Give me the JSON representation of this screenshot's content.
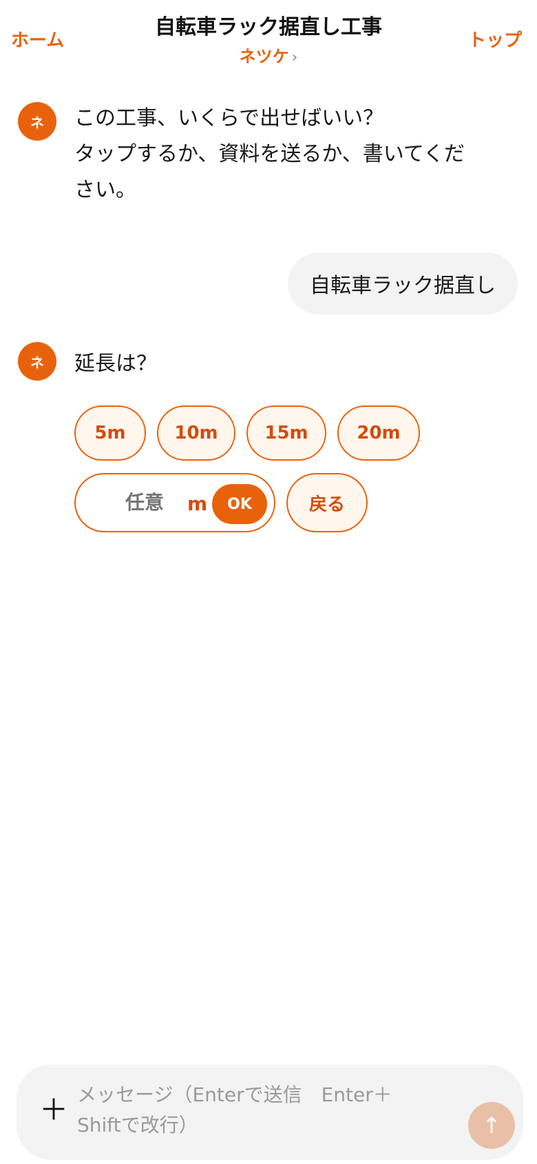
{
  "header": {
    "home_label": "ホーム",
    "top_label": "トップ",
    "title": "自転車ラック据直し工事",
    "assistant_name": "ネツケ",
    "assistant_chevron": "›"
  },
  "messages": [
    {
      "role": "assistant",
      "avatar_text": "ネ",
      "lines": [
        "この工事、いくらで出せばいい？",
        "タップするか、資料を送るか、書いてくだ",
        "さい。"
      ]
    },
    {
      "role": "user",
      "text": "自転車ラック据直し"
    },
    {
      "role": "assistant",
      "avatar_text": "ネ",
      "text": "延長は？"
    }
  ],
  "options": [
    "5m",
    "10m",
    "15m",
    "20m"
  ],
  "custom_input": {
    "placeholder": "任意",
    "unit": "m",
    "ok_label": "OK"
  },
  "back_label": "戻る",
  "composer": {
    "plus_label": "＋",
    "placeholder": "メッセージ（Enterで送信　Enter＋Shiftで改行）",
    "send_icon": "↑"
  },
  "colors": {
    "accent": "#e8620c",
    "chip_bg": "#fff6ee",
    "bubble_bg": "#f3f3f3",
    "send_disabled": "#e8c0a8"
  }
}
